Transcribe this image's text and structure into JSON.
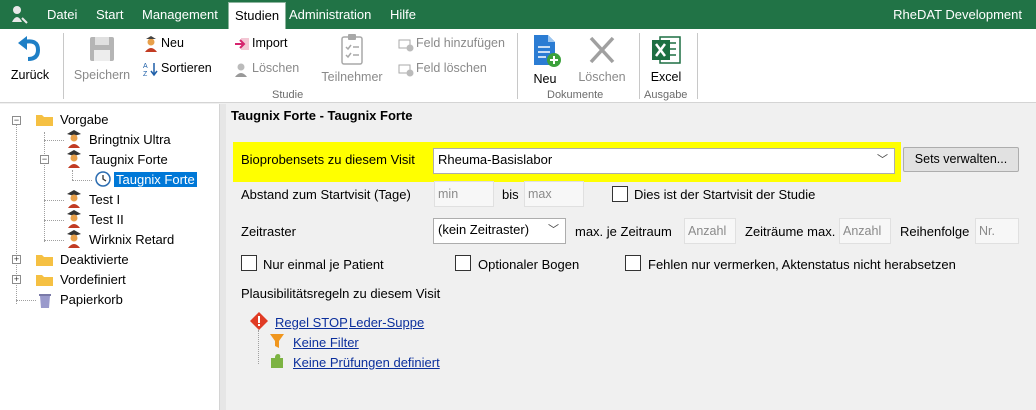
{
  "menubar": {
    "items": [
      "Datei",
      "Start",
      "Management",
      "Studien",
      "Administration",
      "Hilfe"
    ],
    "active": "Studien",
    "app_title": "RheDAT Development"
  },
  "ribbon": {
    "back_label": "Zurück",
    "save_label": "Speichern",
    "new_label": "Neu",
    "sort_label": "Sortieren",
    "import_label": "Import",
    "delete_label": "Löschen",
    "participants_label": "Teilnehmer",
    "add_field_label": "Feld hinzufügen",
    "delete_field_label": "Feld löschen",
    "group_studie": "Studie",
    "doc_new_label": "Neu",
    "doc_delete_label": "Löschen",
    "group_dokumente": "Dokumente",
    "excel_label": "Excel",
    "group_ausgabe": "Ausgabe"
  },
  "tree": {
    "vorgabe": "Vorgabe",
    "bringtnix": "Bringtnix Ultra",
    "taugnix": "Taugnix Forte",
    "taugnix_visit": "Taugnix Forte",
    "test1": "Test I",
    "test2": "Test II",
    "wirknix": "Wirknix Retard",
    "deaktivierte": "Deaktivierte",
    "vordefiniert": "Vordefiniert",
    "papierkorb": "Papierkorb"
  },
  "main": {
    "title": "Taugnix Forte - Taugnix Forte",
    "bioproben_label": "Bioprobensets zu diesem Visit",
    "bioproben_value": "Rheuma-Basislabor",
    "sets_button": "Sets verwalten...",
    "abstand_label": "Abstand zum Startvisit (Tage)",
    "min_placeholder": "min",
    "bis_label": "bis",
    "max_placeholder": "max",
    "startvisit_label": "Dies ist der Startvisit der Studie",
    "zeitraster_label": "Zeitraster",
    "zeitraster_value": "(kein Zeitraster)",
    "max_je_label": "max. je Zeitraum",
    "anzahl_placeholder": "Anzahl",
    "zeitraeume_label": "Zeiträume max.",
    "anzahl2_placeholder": "Anzahl",
    "reihenfolge_label": "Reihenfolge",
    "nr_placeholder": "Nr.",
    "nur_einmal_label": "Nur einmal je Patient",
    "optional_label": "Optionaler Bogen",
    "fehlen_label": "Fehlen nur vermerken, Aktenstatus nicht herabsetzen",
    "plaus_label": "Plausibilitätsregeln zu diesem Visit",
    "regel_link": "Regel STOP",
    "leder_link": "Leder-Suppe",
    "filter_link": "Keine Filter",
    "pruef_link": "Keine Prüfungen definiert"
  },
  "colors": {
    "menubar": "#217346",
    "highlight": "#ffff00",
    "selection": "#0078d7",
    "link": "#0b2f9c"
  }
}
